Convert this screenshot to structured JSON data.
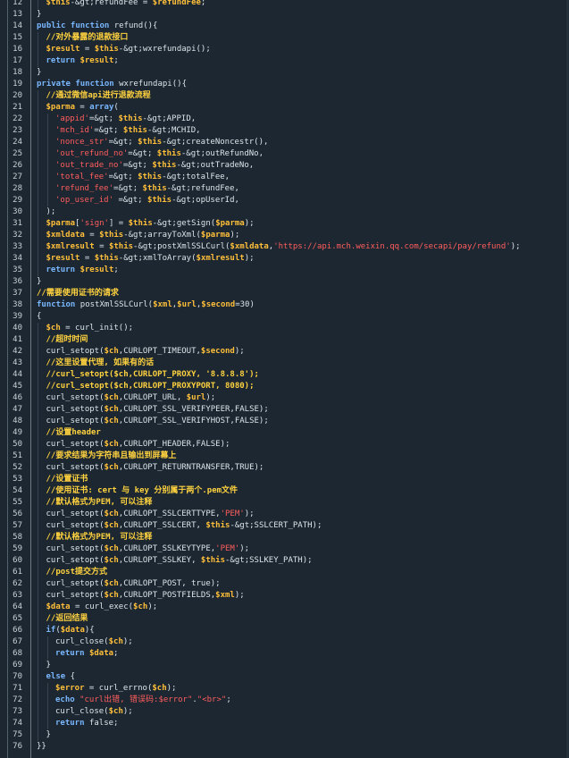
{
  "editor": {
    "lines": [
      {
        "n": "12",
        "indent": 1,
        "tokens": [
          [
            "v",
            "$this"
          ],
          [
            "p",
            "-&gt;refundFee = "
          ],
          [
            "v",
            "$refundFee"
          ],
          [
            "p",
            ";"
          ]
        ]
      },
      {
        "n": "13",
        "indent": 0,
        "tokens": [
          [
            "p",
            "}"
          ]
        ]
      },
      {
        "n": "14",
        "indent": 0,
        "tokens": [
          [
            "k",
            "public function "
          ],
          [
            "p",
            "refund(){"
          ]
        ]
      },
      {
        "n": "15",
        "indent": 1,
        "tokens": [
          [
            "c",
            "//对外暴露的退款接口"
          ]
        ]
      },
      {
        "n": "16",
        "indent": 1,
        "tokens": [
          [
            "v",
            "$result"
          ],
          [
            "p",
            " = "
          ],
          [
            "v",
            "$this"
          ],
          [
            "p",
            "-&gt;wxrefundapi();"
          ]
        ]
      },
      {
        "n": "17",
        "indent": 1,
        "tokens": [
          [
            "k",
            "return "
          ],
          [
            "v",
            "$result"
          ],
          [
            "p",
            ";"
          ]
        ]
      },
      {
        "n": "18",
        "indent": 0,
        "tokens": [
          [
            "p",
            "}"
          ]
        ]
      },
      {
        "n": "19",
        "indent": 0,
        "tokens": [
          [
            "k",
            "private function "
          ],
          [
            "p",
            "wxrefundapi(){"
          ]
        ]
      },
      {
        "n": "20",
        "indent": 1,
        "tokens": [
          [
            "c",
            "//通过微信api进行退款流程"
          ]
        ]
      },
      {
        "n": "21",
        "indent": 1,
        "tokens": [
          [
            "v",
            "$parma"
          ],
          [
            "p",
            " = "
          ],
          [
            "k",
            "array"
          ],
          [
            "p",
            "("
          ]
        ]
      },
      {
        "n": "22",
        "indent": 2,
        "tokens": [
          [
            "s",
            "'appid'"
          ],
          [
            "p",
            "=&gt; "
          ],
          [
            "v",
            "$this"
          ],
          [
            "p",
            "-&gt;APPID,"
          ]
        ]
      },
      {
        "n": "23",
        "indent": 2,
        "tokens": [
          [
            "s",
            "'mch_id'"
          ],
          [
            "p",
            "=&gt; "
          ],
          [
            "v",
            "$this"
          ],
          [
            "p",
            "-&gt;MCHID,"
          ]
        ]
      },
      {
        "n": "24",
        "indent": 2,
        "tokens": [
          [
            "s",
            "'nonce_str'"
          ],
          [
            "p",
            "=&gt; "
          ],
          [
            "v",
            "$this"
          ],
          [
            "p",
            "-&gt;createNoncestr(),"
          ]
        ]
      },
      {
        "n": "25",
        "indent": 2,
        "tokens": [
          [
            "s",
            "'out_refund_no'"
          ],
          [
            "p",
            "=&gt; "
          ],
          [
            "v",
            "$this"
          ],
          [
            "p",
            "-&gt;outRefundNo,"
          ]
        ]
      },
      {
        "n": "26",
        "indent": 2,
        "tokens": [
          [
            "s",
            "'out_trade_no'"
          ],
          [
            "p",
            "=&gt; "
          ],
          [
            "v",
            "$this"
          ],
          [
            "p",
            "-&gt;outTradeNo,"
          ]
        ]
      },
      {
        "n": "27",
        "indent": 2,
        "tokens": [
          [
            "s",
            "'total_fee'"
          ],
          [
            "p",
            "=&gt; "
          ],
          [
            "v",
            "$this"
          ],
          [
            "p",
            "-&gt;totalFee,"
          ]
        ]
      },
      {
        "n": "28",
        "indent": 2,
        "tokens": [
          [
            "s",
            "'refund_fee'"
          ],
          [
            "p",
            "=&gt; "
          ],
          [
            "v",
            "$this"
          ],
          [
            "p",
            "-&gt;refundFee,"
          ]
        ]
      },
      {
        "n": "29",
        "indent": 2,
        "tokens": [
          [
            "s",
            "'op_user_id'"
          ],
          [
            "p",
            " =&gt; "
          ],
          [
            "v",
            "$this"
          ],
          [
            "p",
            "-&gt;opUserId,"
          ]
        ]
      },
      {
        "n": "30",
        "indent": 1,
        "tokens": [
          [
            "p",
            ");"
          ]
        ]
      },
      {
        "n": "31",
        "indent": 1,
        "tokens": [
          [
            "v",
            "$parma"
          ],
          [
            "p",
            "["
          ],
          [
            "s",
            "'sign'"
          ],
          [
            "p",
            "] = "
          ],
          [
            "v",
            "$this"
          ],
          [
            "p",
            "-&gt;getSign("
          ],
          [
            "v",
            "$parma"
          ],
          [
            "p",
            ");"
          ]
        ]
      },
      {
        "n": "32",
        "indent": 1,
        "tokens": [
          [
            "v",
            "$xmldata"
          ],
          [
            "p",
            " = "
          ],
          [
            "v",
            "$this"
          ],
          [
            "p",
            "-&gt;arrayToXml("
          ],
          [
            "v",
            "$parma"
          ],
          [
            "p",
            ");"
          ]
        ]
      },
      {
        "n": "33",
        "indent": 1,
        "tokens": [
          [
            "v",
            "$xmlresult"
          ],
          [
            "p",
            " = "
          ],
          [
            "v",
            "$this"
          ],
          [
            "p",
            "-&gt;postXmlSSLCurl("
          ],
          [
            "v",
            "$xmldata"
          ],
          [
            "p",
            ","
          ],
          [
            "s",
            "'https://api.mch.weixin.qq.com/secapi/pay/refund'"
          ],
          [
            "p",
            ");"
          ]
        ]
      },
      {
        "n": "34",
        "indent": 1,
        "tokens": [
          [
            "v",
            "$result"
          ],
          [
            "p",
            " = "
          ],
          [
            "v",
            "$this"
          ],
          [
            "p",
            "-&gt;xmlToArray("
          ],
          [
            "v",
            "$xmlresult"
          ],
          [
            "p",
            ");"
          ]
        ]
      },
      {
        "n": "35",
        "indent": 1,
        "tokens": [
          [
            "k",
            "return "
          ],
          [
            "v",
            "$result"
          ],
          [
            "p",
            ";"
          ]
        ]
      },
      {
        "n": "36",
        "indent": 0,
        "tokens": [
          [
            "p",
            "}"
          ]
        ]
      },
      {
        "n": "37",
        "indent": 0,
        "tokens": [
          [
            "c",
            "//需要使用证书的请求"
          ]
        ]
      },
      {
        "n": "38",
        "indent": 0,
        "tokens": [
          [
            "k",
            "function "
          ],
          [
            "p",
            "postXmlSSLCurl("
          ],
          [
            "v",
            "$xml"
          ],
          [
            "p",
            ","
          ],
          [
            "v",
            "$url"
          ],
          [
            "p",
            ","
          ],
          [
            "v",
            "$second"
          ],
          [
            "p",
            "=30)"
          ]
        ]
      },
      {
        "n": "39",
        "indent": 0,
        "tokens": [
          [
            "p",
            "{"
          ]
        ]
      },
      {
        "n": "40",
        "indent": 1,
        "tokens": [
          [
            "v",
            "$ch"
          ],
          [
            "p",
            " = curl_init();"
          ]
        ]
      },
      {
        "n": "41",
        "indent": 1,
        "tokens": [
          [
            "c",
            "//超时时间"
          ]
        ]
      },
      {
        "n": "42",
        "indent": 1,
        "tokens": [
          [
            "p",
            "curl_setopt("
          ],
          [
            "v",
            "$ch"
          ],
          [
            "p",
            ",CURLOPT_TIMEOUT,"
          ],
          [
            "v",
            "$second"
          ],
          [
            "p",
            ");"
          ]
        ]
      },
      {
        "n": "43",
        "indent": 1,
        "tokens": [
          [
            "c",
            "//这里设置代理, 如果有的话"
          ]
        ]
      },
      {
        "n": "44",
        "indent": 1,
        "tokens": [
          [
            "c",
            "//curl_setopt($ch,CURLOPT_PROXY, '8.8.8.8');"
          ]
        ]
      },
      {
        "n": "45",
        "indent": 1,
        "tokens": [
          [
            "c",
            "//curl_setopt($ch,CURLOPT_PROXYPORT, 8080);"
          ]
        ]
      },
      {
        "n": "46",
        "indent": 1,
        "tokens": [
          [
            "p",
            "curl_setopt("
          ],
          [
            "v",
            "$ch"
          ],
          [
            "p",
            ",CURLOPT_URL, "
          ],
          [
            "v",
            "$url"
          ],
          [
            "p",
            ");"
          ]
        ]
      },
      {
        "n": "47",
        "indent": 1,
        "tokens": [
          [
            "p",
            "curl_setopt("
          ],
          [
            "v",
            "$ch"
          ],
          [
            "p",
            ",CURLOPT_SSL_VERIFYPEER,FALSE);"
          ]
        ]
      },
      {
        "n": "48",
        "indent": 1,
        "tokens": [
          [
            "p",
            "curl_setopt("
          ],
          [
            "v",
            "$ch"
          ],
          [
            "p",
            ",CURLOPT_SSL_VERIFYHOST,FALSE);"
          ]
        ]
      },
      {
        "n": "49",
        "indent": 1,
        "tokens": [
          [
            "c",
            "//设置header"
          ]
        ]
      },
      {
        "n": "50",
        "indent": 1,
        "tokens": [
          [
            "p",
            "curl_setopt("
          ],
          [
            "v",
            "$ch"
          ],
          [
            "p",
            ",CURLOPT_HEADER,FALSE);"
          ]
        ]
      },
      {
        "n": "51",
        "indent": 1,
        "tokens": [
          [
            "c",
            "//要求结果为字符串且输出到屏幕上"
          ]
        ]
      },
      {
        "n": "52",
        "indent": 1,
        "tokens": [
          [
            "p",
            "curl_setopt("
          ],
          [
            "v",
            "$ch"
          ],
          [
            "p",
            ",CURLOPT_RETURNTRANSFER,TRUE);"
          ]
        ]
      },
      {
        "n": "53",
        "indent": 1,
        "tokens": [
          [
            "c",
            "//设置证书"
          ]
        ]
      },
      {
        "n": "54",
        "indent": 1,
        "tokens": [
          [
            "c",
            "//使用证书: cert 与 key 分别属于两个.pem文件"
          ]
        ]
      },
      {
        "n": "55",
        "indent": 1,
        "tokens": [
          [
            "c",
            "//默认格式为PEM, 可以注释"
          ]
        ]
      },
      {
        "n": "56",
        "indent": 1,
        "tokens": [
          [
            "p",
            "curl_setopt("
          ],
          [
            "v",
            "$ch"
          ],
          [
            "p",
            ",CURLOPT_SSLCERTTYPE,"
          ],
          [
            "s",
            "'PEM'"
          ],
          [
            "p",
            ");"
          ]
        ]
      },
      {
        "n": "57",
        "indent": 1,
        "tokens": [
          [
            "p",
            "curl_setopt("
          ],
          [
            "v",
            "$ch"
          ],
          [
            "p",
            ",CURLOPT_SSLCERT, "
          ],
          [
            "v",
            "$this"
          ],
          [
            "p",
            "-&gt;SSLCERT_PATH);"
          ]
        ]
      },
      {
        "n": "58",
        "indent": 1,
        "tokens": [
          [
            "c",
            "//默认格式为PEM, 可以注释"
          ]
        ]
      },
      {
        "n": "59",
        "indent": 1,
        "tokens": [
          [
            "p",
            "curl_setopt("
          ],
          [
            "v",
            "$ch"
          ],
          [
            "p",
            ",CURLOPT_SSLKEYTYPE,"
          ],
          [
            "s",
            "'PEM'"
          ],
          [
            "p",
            ");"
          ]
        ]
      },
      {
        "n": "60",
        "indent": 1,
        "tokens": [
          [
            "p",
            "curl_setopt("
          ],
          [
            "v",
            "$ch"
          ],
          [
            "p",
            ",CURLOPT_SSLKEY, "
          ],
          [
            "v",
            "$this"
          ],
          [
            "p",
            "-&gt;SSLKEY_PATH);"
          ]
        ]
      },
      {
        "n": "61",
        "indent": 1,
        "tokens": [
          [
            "c",
            "//post提交方式"
          ]
        ]
      },
      {
        "n": "62",
        "indent": 1,
        "tokens": [
          [
            "p",
            "curl_setopt("
          ],
          [
            "v",
            "$ch"
          ],
          [
            "p",
            ",CURLOPT_POST, true);"
          ]
        ]
      },
      {
        "n": "63",
        "indent": 1,
        "tokens": [
          [
            "p",
            "curl_setopt("
          ],
          [
            "v",
            "$ch"
          ],
          [
            "p",
            ",CURLOPT_POSTFIELDS,"
          ],
          [
            "v",
            "$xml"
          ],
          [
            "p",
            ");"
          ]
        ]
      },
      {
        "n": "64",
        "indent": 1,
        "tokens": [
          [
            "v",
            "$data"
          ],
          [
            "p",
            " = curl_exec("
          ],
          [
            "v",
            "$ch"
          ],
          [
            "p",
            ");"
          ]
        ]
      },
      {
        "n": "65",
        "indent": 1,
        "tokens": [
          [
            "c",
            "//返回结果"
          ]
        ]
      },
      {
        "n": "66",
        "indent": 1,
        "tokens": [
          [
            "k",
            "if"
          ],
          [
            "p",
            "("
          ],
          [
            "v",
            "$data"
          ],
          [
            "p",
            "){"
          ]
        ]
      },
      {
        "n": "67",
        "indent": 2,
        "tokens": [
          [
            "p",
            "curl_close("
          ],
          [
            "v",
            "$ch"
          ],
          [
            "p",
            ");"
          ]
        ]
      },
      {
        "n": "68",
        "indent": 2,
        "tokens": [
          [
            "k",
            "return "
          ],
          [
            "v",
            "$data"
          ],
          [
            "p",
            ";"
          ]
        ]
      },
      {
        "n": "69",
        "indent": 1,
        "tokens": [
          [
            "p",
            "}"
          ]
        ]
      },
      {
        "n": "70",
        "indent": 1,
        "tokens": [
          [
            "k",
            "else "
          ],
          [
            "p",
            "{"
          ]
        ]
      },
      {
        "n": "71",
        "indent": 2,
        "tokens": [
          [
            "v",
            "$error"
          ],
          [
            "p",
            " = curl_errno("
          ],
          [
            "v",
            "$ch"
          ],
          [
            "p",
            ");"
          ]
        ]
      },
      {
        "n": "72",
        "indent": 2,
        "tokens": [
          [
            "k",
            "echo "
          ],
          [
            "s",
            "\"curl出错, 错误码:$error\""
          ],
          [
            "p",
            "."
          ],
          [
            "s",
            "\"<br>\""
          ],
          [
            "p",
            ";"
          ]
        ]
      },
      {
        "n": "73",
        "indent": 2,
        "tokens": [
          [
            "p",
            "curl_close("
          ],
          [
            "v",
            "$ch"
          ],
          [
            "p",
            ");"
          ]
        ]
      },
      {
        "n": "74",
        "indent": 2,
        "tokens": [
          [
            "k",
            "return "
          ],
          [
            "p",
            "false;"
          ]
        ]
      },
      {
        "n": "75",
        "indent": 1,
        "tokens": [
          [
            "p",
            "}"
          ]
        ]
      },
      {
        "n": "76",
        "indent": 0,
        "tokens": [
          [
            "p",
            "}}"
          ]
        ]
      }
    ]
  },
  "colors": {
    "background": "#1c2731",
    "keyword": "#7ab7ff",
    "variable": "#ffbf3a",
    "string": "#ff5d5d",
    "comment": "#ffd23f",
    "plain": "#dde4ea",
    "line_number": "#c9d1d7"
  }
}
